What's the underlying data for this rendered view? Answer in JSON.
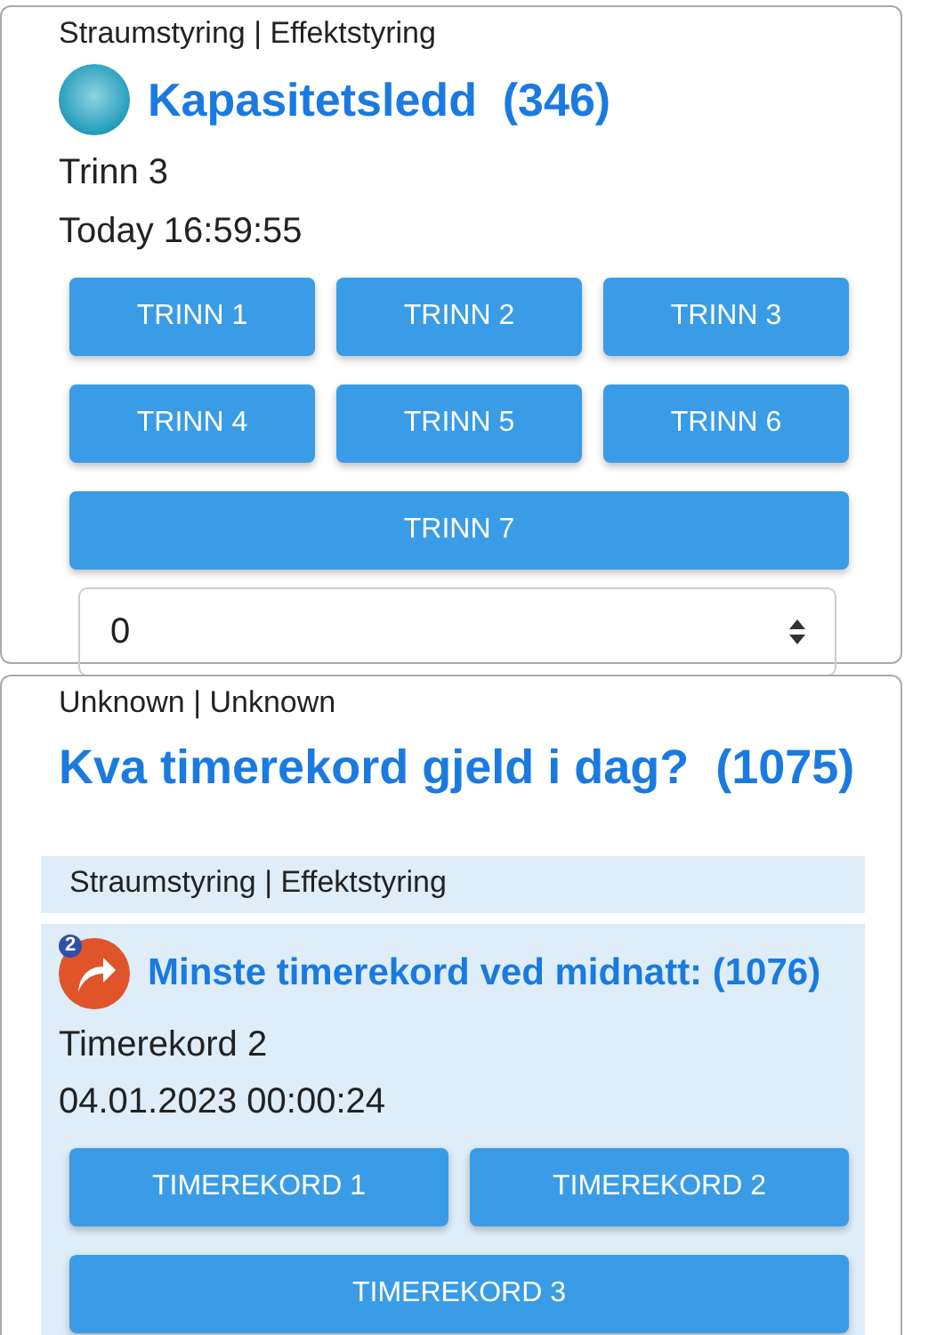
{
  "device_card": {
    "category": "Straumstyring | Effektstyring",
    "title": "Kapasitetsledd  (346)",
    "state": "Trinn 3",
    "timestamp": "Today 16:59:55",
    "buttons": [
      "TRINN 1",
      "TRINN 2",
      "TRINN 3",
      "TRINN 4",
      "TRINN 5",
      "TRINN 6",
      "TRINN 7"
    ],
    "select": {
      "value": "0"
    }
  },
  "scene_card": {
    "category": "Unknown | Unknown",
    "title": "Kva timerekord gjeld i dag?  (1075)",
    "group": {
      "category": "Straumstyring | Effektstyring",
      "item": {
        "badge": "2",
        "title": "Minste timerekord ved midnatt: (1076)",
        "state": "Timerekord 2",
        "timestamp": "04.01.2023 00:00:24",
        "buttons": [
          "TIMEREKORD 1",
          "TIMEREKORD 2",
          "TIMEREKORD 3"
        ]
      }
    }
  }
}
